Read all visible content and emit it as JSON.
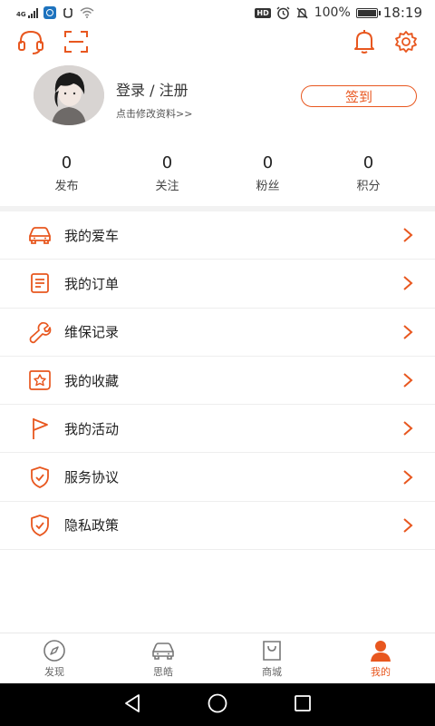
{
  "status_bar": {
    "network_type": "4G",
    "battery_text": "100%",
    "battery_level": 1.0,
    "time": "18:19",
    "hd_label": "HD"
  },
  "profile": {
    "login_label": "登录 / 注册",
    "edit_hint": "点击修改资料>>",
    "checkin_label": "签到"
  },
  "stats": [
    {
      "value": "0",
      "label": "发布"
    },
    {
      "value": "0",
      "label": "关注"
    },
    {
      "value": "0",
      "label": "粉丝"
    },
    {
      "value": "0",
      "label": "积分"
    }
  ],
  "menu": [
    {
      "label": "我的爱车",
      "icon": "car-icon"
    },
    {
      "label": "我的订单",
      "icon": "order-icon"
    },
    {
      "label": "维保记录",
      "icon": "wrench-icon"
    },
    {
      "label": "我的收藏",
      "icon": "favorite-icon"
    },
    {
      "label": "我的活动",
      "icon": "flag-icon"
    },
    {
      "label": "服务协议",
      "icon": "shield-check-icon"
    },
    {
      "label": "隐私政策",
      "icon": "shield-check-icon"
    }
  ],
  "tabs": [
    {
      "label": "发现",
      "icon": "compass-icon",
      "active": false
    },
    {
      "label": "思皓",
      "icon": "car-icon",
      "active": false
    },
    {
      "label": "商城",
      "icon": "shopping-bag-icon",
      "active": false
    },
    {
      "label": "我的",
      "icon": "user-icon",
      "active": true
    }
  ],
  "colors": {
    "accent": "#e8571f",
    "text": "#222222",
    "divider": "#eeeeee"
  }
}
